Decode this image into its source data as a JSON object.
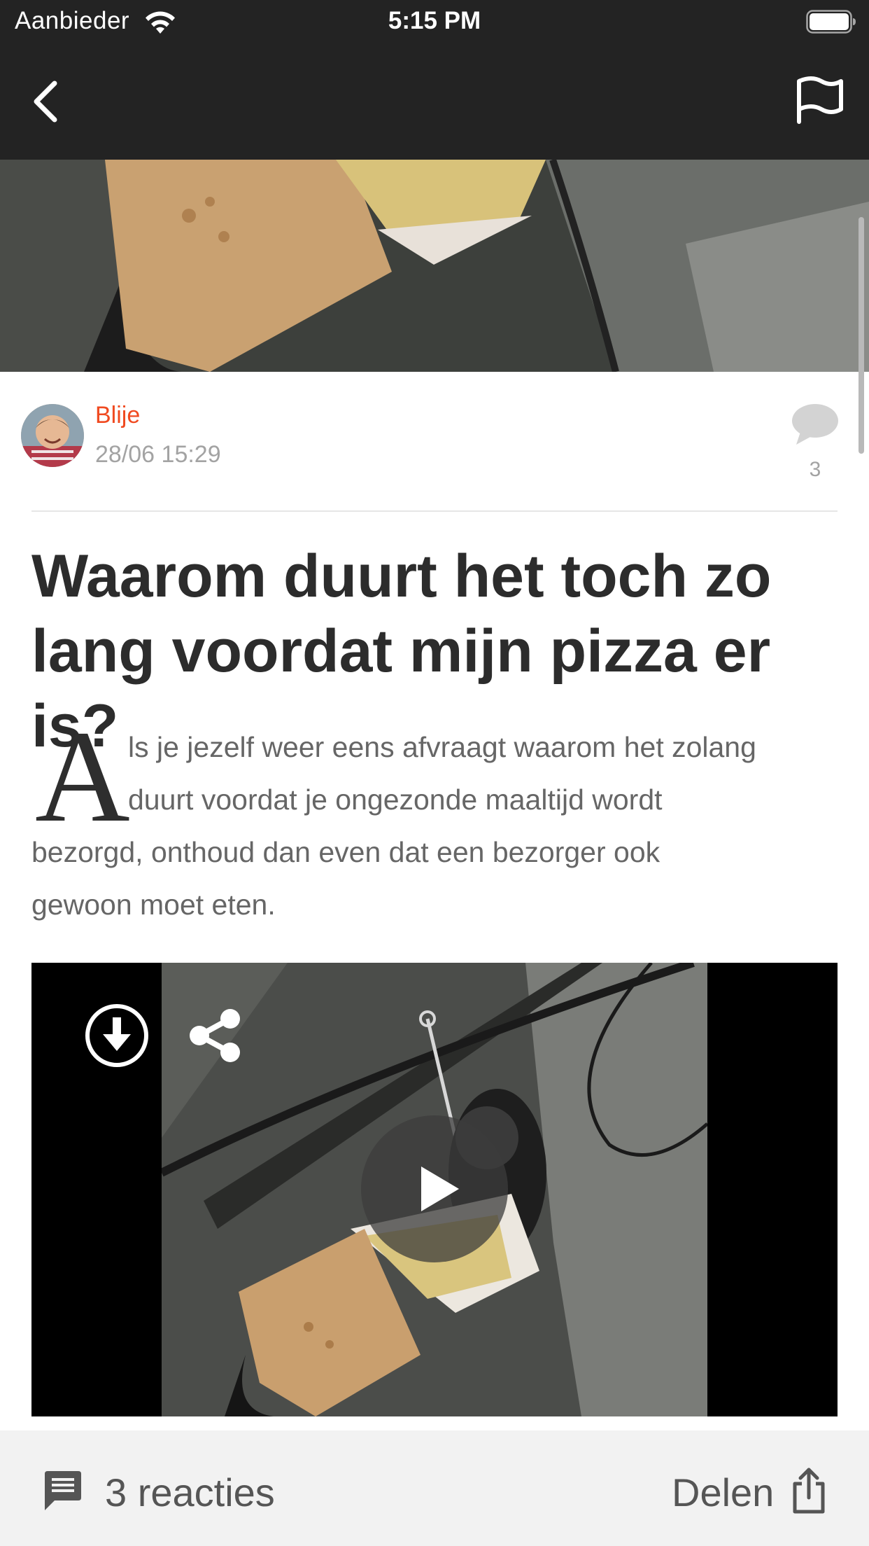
{
  "status_bar": {
    "carrier": "Aanbieder",
    "time": "5:15 PM"
  },
  "nav": {
    "back_icon": "chevron-left-icon",
    "report_icon": "flag-icon"
  },
  "post": {
    "author": "Blije",
    "date": "28/06 15:29",
    "comment_count": "3",
    "title": "Waarom duurt het toch zo lang voordat mijn pizza er is?",
    "dropcap": "A",
    "body_lines": [
      "ls je jezelf weer eens afvraagt waarom het zolang",
      "duurt voordat je ongezonde maaltijd wordt",
      "bezorgd, onthoud dan even dat een bezorger ook",
      "gewoon moet eten."
    ]
  },
  "video": {
    "download_icon": "download-icon",
    "share_icon": "share-icon",
    "play_icon": "play-icon"
  },
  "bottom_bar": {
    "reacties_label": "3 reacties",
    "delen_label": "Delen"
  },
  "colors": {
    "topbar": "#232323",
    "author_accent": "#f04a20",
    "bottombar": "#f2f2f2"
  }
}
